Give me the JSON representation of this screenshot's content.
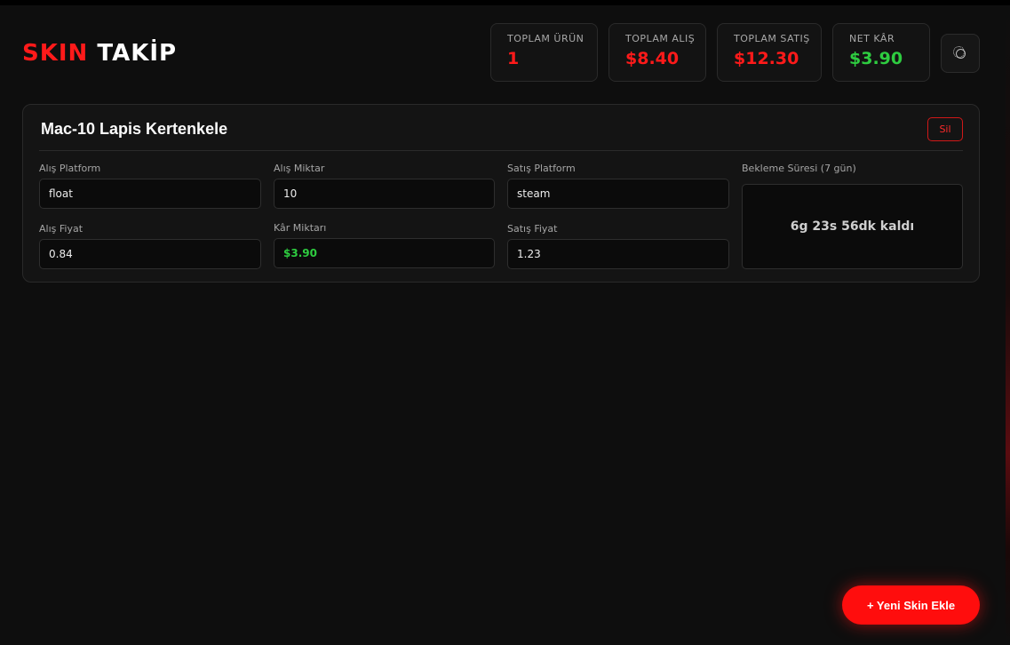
{
  "header": {
    "logo_part1": "SKIN",
    "logo_part2": "TAKİP"
  },
  "stats": [
    {
      "label": "TOPLAM ÜRÜN",
      "value": "1",
      "color": "#ff1a1a"
    },
    {
      "label": "TOPLAM ALIŞ",
      "value": "$8.40",
      "color": "#ff1a1a"
    },
    {
      "label": "TOPLAM SATIŞ",
      "value": "$12.30",
      "color": "#ff1a1a"
    },
    {
      "label": "NET KÂR",
      "value": "$3.90",
      "color": "#2ecc40"
    }
  ],
  "settings_icon": "gear-icon",
  "item": {
    "title": "Mac-10 Lapis Kertenkele",
    "delete_label": "Sil",
    "fields": {
      "buy_platform": {
        "label": "Alış Platform",
        "value": "float"
      },
      "buy_amount": {
        "label": "Alış Miktar",
        "value": "10"
      },
      "sell_platform": {
        "label": "Satış Platform",
        "value": "steam"
      },
      "buy_price": {
        "label": "Alış Fiyat",
        "value": "0.84"
      },
      "profit_amount": {
        "label": "Kâr Miktarı",
        "value": "$3.90"
      },
      "sell_price": {
        "label": "Satış Fiyat",
        "value": "1.23"
      }
    },
    "wait": {
      "label": "Bekleme Süresi (7 gün)",
      "remaining": "6g 23s 56dk kaldı"
    }
  },
  "add_button_label": "+ Yeni Skin Ekle",
  "colors": {
    "accent": "#ff0d0d",
    "profit": "#2ecc40",
    "background": "#0e0e0e"
  }
}
